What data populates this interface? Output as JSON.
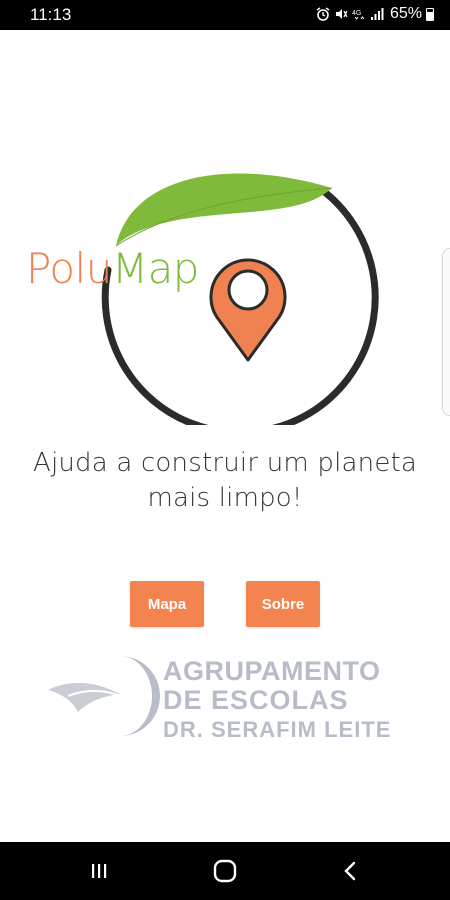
{
  "status_bar": {
    "time": "11:13",
    "battery": "65%",
    "icons": [
      "alarm-icon",
      "mute-icon",
      "4g-icon",
      "signal-icon",
      "battery-icon"
    ]
  },
  "logo": {
    "text_part1": "Polu",
    "text_part2": "Map",
    "colors": {
      "orange": "#f08150",
      "green": "#7fba3a",
      "ring": "#2b2b2b"
    }
  },
  "tagline": {
    "line1": "Ajuda a construir um planeta",
    "line2": "mais limpo!"
  },
  "buttons": {
    "mapa_label": "Mapa",
    "sobre_label": "Sobre",
    "color": "#f4844f"
  },
  "school": {
    "line1": "AGRUPAMENTO",
    "line2": "DE ESCOLAS",
    "line3": "DR. SERAFIM LEITE",
    "color": "#b7bcc8"
  },
  "nav_bar": {
    "icons": [
      "recents-icon",
      "home-icon",
      "back-icon"
    ]
  }
}
